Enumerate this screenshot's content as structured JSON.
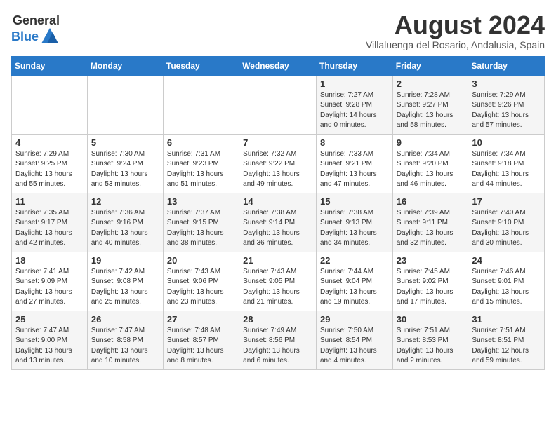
{
  "logo": {
    "general": "General",
    "blue": "Blue"
  },
  "title": "August 2024",
  "subtitle": "Villaluenga del Rosario, Andalusia, Spain",
  "headers": [
    "Sunday",
    "Monday",
    "Tuesday",
    "Wednesday",
    "Thursday",
    "Friday",
    "Saturday"
  ],
  "weeks": [
    [
      {
        "day": "",
        "info": ""
      },
      {
        "day": "",
        "info": ""
      },
      {
        "day": "",
        "info": ""
      },
      {
        "day": "",
        "info": ""
      },
      {
        "day": "1",
        "info": "Sunrise: 7:27 AM\nSunset: 9:28 PM\nDaylight: 14 hours\nand 0 minutes."
      },
      {
        "day": "2",
        "info": "Sunrise: 7:28 AM\nSunset: 9:27 PM\nDaylight: 13 hours\nand 58 minutes."
      },
      {
        "day": "3",
        "info": "Sunrise: 7:29 AM\nSunset: 9:26 PM\nDaylight: 13 hours\nand 57 minutes."
      }
    ],
    [
      {
        "day": "4",
        "info": "Sunrise: 7:29 AM\nSunset: 9:25 PM\nDaylight: 13 hours\nand 55 minutes."
      },
      {
        "day": "5",
        "info": "Sunrise: 7:30 AM\nSunset: 9:24 PM\nDaylight: 13 hours\nand 53 minutes."
      },
      {
        "day": "6",
        "info": "Sunrise: 7:31 AM\nSunset: 9:23 PM\nDaylight: 13 hours\nand 51 minutes."
      },
      {
        "day": "7",
        "info": "Sunrise: 7:32 AM\nSunset: 9:22 PM\nDaylight: 13 hours\nand 49 minutes."
      },
      {
        "day": "8",
        "info": "Sunrise: 7:33 AM\nSunset: 9:21 PM\nDaylight: 13 hours\nand 47 minutes."
      },
      {
        "day": "9",
        "info": "Sunrise: 7:34 AM\nSunset: 9:20 PM\nDaylight: 13 hours\nand 46 minutes."
      },
      {
        "day": "10",
        "info": "Sunrise: 7:34 AM\nSunset: 9:18 PM\nDaylight: 13 hours\nand 44 minutes."
      }
    ],
    [
      {
        "day": "11",
        "info": "Sunrise: 7:35 AM\nSunset: 9:17 PM\nDaylight: 13 hours\nand 42 minutes."
      },
      {
        "day": "12",
        "info": "Sunrise: 7:36 AM\nSunset: 9:16 PM\nDaylight: 13 hours\nand 40 minutes."
      },
      {
        "day": "13",
        "info": "Sunrise: 7:37 AM\nSunset: 9:15 PM\nDaylight: 13 hours\nand 38 minutes."
      },
      {
        "day": "14",
        "info": "Sunrise: 7:38 AM\nSunset: 9:14 PM\nDaylight: 13 hours\nand 36 minutes."
      },
      {
        "day": "15",
        "info": "Sunrise: 7:38 AM\nSunset: 9:13 PM\nDaylight: 13 hours\nand 34 minutes."
      },
      {
        "day": "16",
        "info": "Sunrise: 7:39 AM\nSunset: 9:11 PM\nDaylight: 13 hours\nand 32 minutes."
      },
      {
        "day": "17",
        "info": "Sunrise: 7:40 AM\nSunset: 9:10 PM\nDaylight: 13 hours\nand 30 minutes."
      }
    ],
    [
      {
        "day": "18",
        "info": "Sunrise: 7:41 AM\nSunset: 9:09 PM\nDaylight: 13 hours\nand 27 minutes."
      },
      {
        "day": "19",
        "info": "Sunrise: 7:42 AM\nSunset: 9:08 PM\nDaylight: 13 hours\nand 25 minutes."
      },
      {
        "day": "20",
        "info": "Sunrise: 7:43 AM\nSunset: 9:06 PM\nDaylight: 13 hours\nand 23 minutes."
      },
      {
        "day": "21",
        "info": "Sunrise: 7:43 AM\nSunset: 9:05 PM\nDaylight: 13 hours\nand 21 minutes."
      },
      {
        "day": "22",
        "info": "Sunrise: 7:44 AM\nSunset: 9:04 PM\nDaylight: 13 hours\nand 19 minutes."
      },
      {
        "day": "23",
        "info": "Sunrise: 7:45 AM\nSunset: 9:02 PM\nDaylight: 13 hours\nand 17 minutes."
      },
      {
        "day": "24",
        "info": "Sunrise: 7:46 AM\nSunset: 9:01 PM\nDaylight: 13 hours\nand 15 minutes."
      }
    ],
    [
      {
        "day": "25",
        "info": "Sunrise: 7:47 AM\nSunset: 9:00 PM\nDaylight: 13 hours\nand 13 minutes."
      },
      {
        "day": "26",
        "info": "Sunrise: 7:47 AM\nSunset: 8:58 PM\nDaylight: 13 hours\nand 10 minutes."
      },
      {
        "day": "27",
        "info": "Sunrise: 7:48 AM\nSunset: 8:57 PM\nDaylight: 13 hours\nand 8 minutes."
      },
      {
        "day": "28",
        "info": "Sunrise: 7:49 AM\nSunset: 8:56 PM\nDaylight: 13 hours\nand 6 minutes."
      },
      {
        "day": "29",
        "info": "Sunrise: 7:50 AM\nSunset: 8:54 PM\nDaylight: 13 hours\nand 4 minutes."
      },
      {
        "day": "30",
        "info": "Sunrise: 7:51 AM\nSunset: 8:53 PM\nDaylight: 13 hours\nand 2 minutes."
      },
      {
        "day": "31",
        "info": "Sunrise: 7:51 AM\nSunset: 8:51 PM\nDaylight: 12 hours\nand 59 minutes."
      }
    ]
  ]
}
